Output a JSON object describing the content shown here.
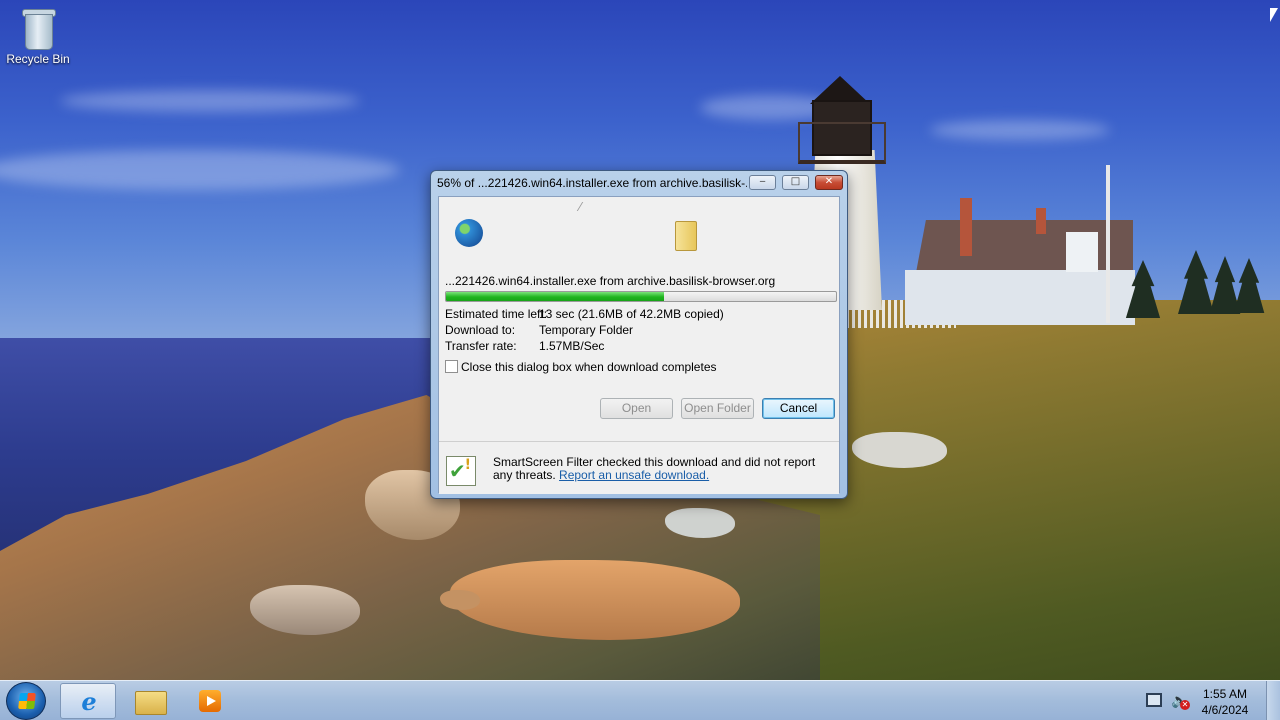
{
  "desktop": {
    "icons": [
      {
        "label": "Recycle Bin",
        "icon": "recycle-bin-icon"
      }
    ]
  },
  "dialog": {
    "title": "56% of ...221426.win64.installer.exe from archive.basilisk-...",
    "controls": {
      "minimize": "‒",
      "maximize": "□",
      "close": "✕"
    },
    "file_line": "...221426.win64.installer.exe from archive.basilisk-browser.org",
    "progress_percent": 56,
    "rows": [
      {
        "label": "Estimated time left:",
        "value": "13 sec (21.6MB of 42.2MB copied)"
      },
      {
        "label": "Download to:",
        "value": "Temporary Folder"
      },
      {
        "label": "Transfer rate:",
        "value": "1.57MB/Sec"
      }
    ],
    "checkbox_label": "Close this dialog box when download completes",
    "checkbox_checked": false,
    "buttons": {
      "open": "Open",
      "open_folder": "Open Folder",
      "cancel": "Cancel"
    },
    "smartscreen": {
      "text": "SmartScreen Filter checked this download and did not report any threats.",
      "link": "Report an unsafe download."
    }
  },
  "taskbar": {
    "apps": [
      {
        "name": "Internet Explorer",
        "icon": "ie-icon",
        "active": true
      },
      {
        "name": "Windows Explorer",
        "icon": "folder-icon",
        "active": false
      },
      {
        "name": "Media Player",
        "icon": "media-player-icon",
        "active": false
      }
    ],
    "clock": {
      "time": "1:55 AM",
      "date": "4/6/2024"
    }
  },
  "colors": {
    "progress_fill": "#1fb51f",
    "link": "#1a5ea8",
    "close_button": "#c74d35"
  }
}
